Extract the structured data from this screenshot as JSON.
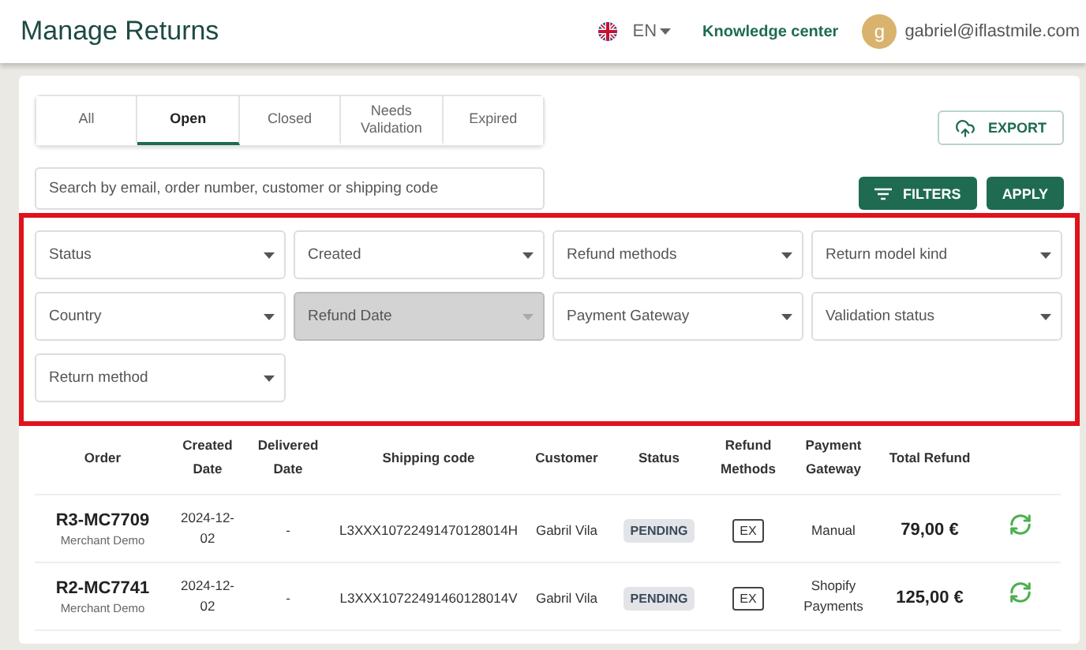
{
  "header": {
    "title": "Manage Returns",
    "language": "EN",
    "help_link": "Knowledge center",
    "user": {
      "initial": "g",
      "email": "gabriel@iflastmile.com"
    }
  },
  "tabs": [
    {
      "label": "All",
      "selected": false
    },
    {
      "label": "Open",
      "selected": true
    },
    {
      "label": "Closed",
      "selected": false
    },
    {
      "label": "Needs Validation",
      "selected": false
    },
    {
      "label": "Expired",
      "selected": false
    }
  ],
  "export_button": "EXPORT",
  "search": {
    "placeholder": "Search by email, order number, customer or shipping code"
  },
  "filters_button": "FILTERS",
  "apply_button": "APPLY",
  "filters": [
    {
      "label": "Status",
      "disabled": false
    },
    {
      "label": "Created",
      "disabled": false
    },
    {
      "label": "Refund methods",
      "disabled": false
    },
    {
      "label": "Return model kind",
      "disabled": false
    },
    {
      "label": "Country",
      "disabled": false
    },
    {
      "label": "Refund Date",
      "disabled": true
    },
    {
      "label": "Payment Gateway",
      "disabled": false
    },
    {
      "label": "Validation status",
      "disabled": false
    },
    {
      "label": "Return method",
      "disabled": false
    }
  ],
  "table": {
    "columns": [
      "Order",
      "Created Date",
      "Delivered Date",
      "Shipping code",
      "Customer",
      "Status",
      "Refund Methods",
      "Payment Gateway",
      "Total Refund"
    ],
    "rows": [
      {
        "order": "R3-MC7709",
        "merchant": "Merchant Demo",
        "created": "2024-12-02",
        "delivered": "-",
        "shipping_code": "L3XXX10722491470128014H",
        "customer": "Gabril Vila",
        "status": "PENDING",
        "refund_method": "EX",
        "gateway": "Manual",
        "total": "79,00 €"
      },
      {
        "order": "R2-MC7741",
        "merchant": "Merchant Demo",
        "created": "2024-12-02",
        "delivered": "-",
        "shipping_code": "L3XXX10722491460128014V",
        "customer": "Gabril Vila",
        "status": "PENDING",
        "refund_method": "EX",
        "gateway": "Shopify Payments",
        "total": "125,00 €"
      }
    ]
  }
}
